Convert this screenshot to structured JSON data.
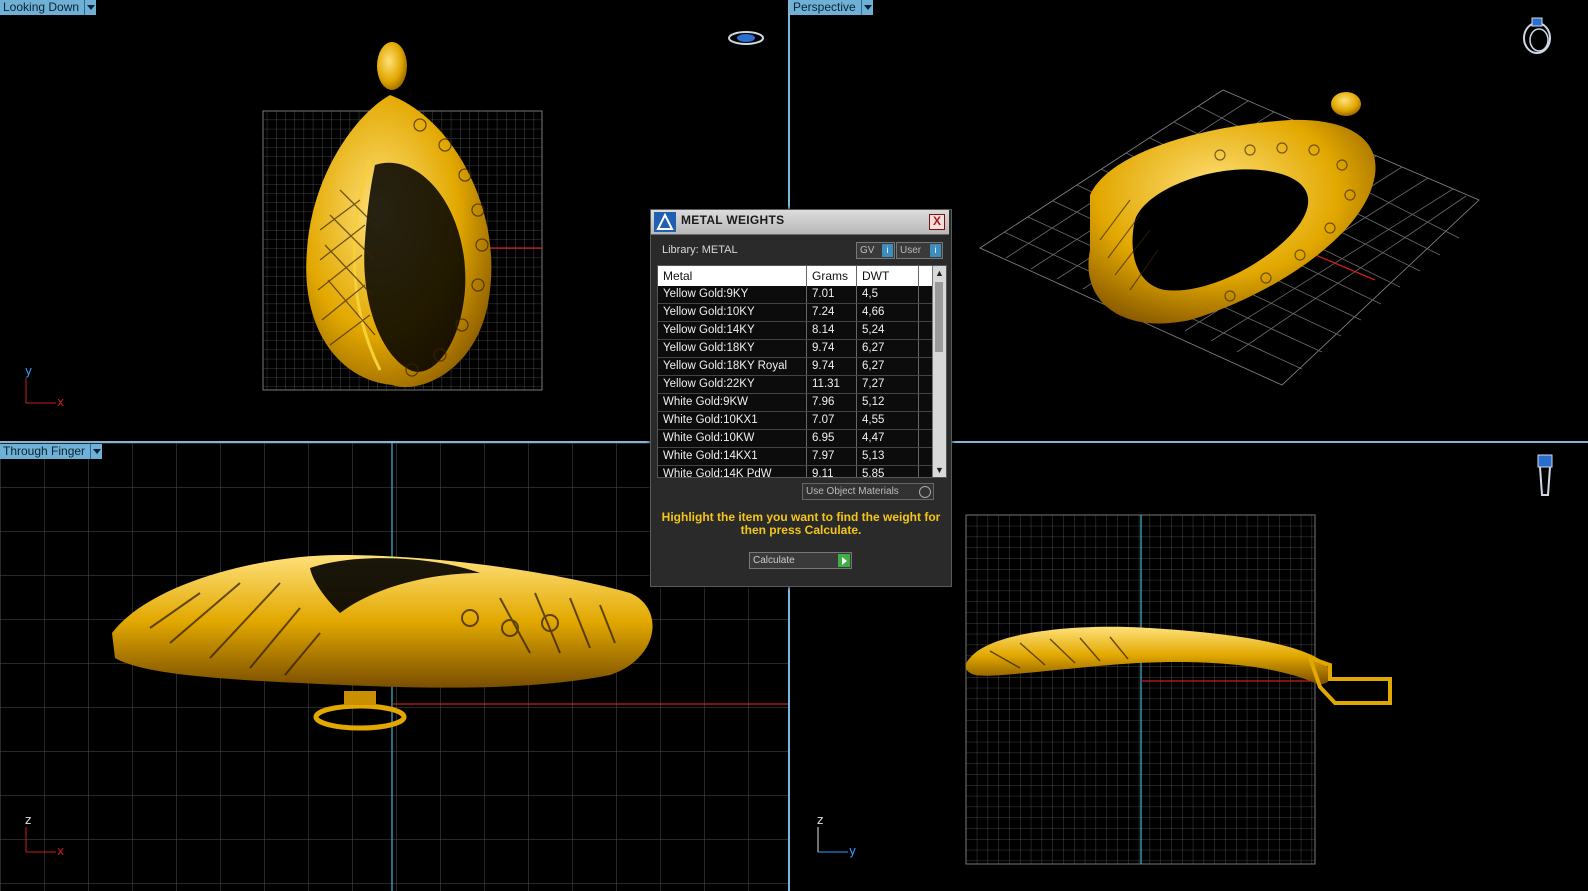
{
  "viewports": {
    "top_left": {
      "label": "Looking Down",
      "axis_a": "y",
      "axis_b": "x"
    },
    "top_right": {
      "label": "Perspective"
    },
    "bottom_left": {
      "label": "Through Finger",
      "axis_a": "z",
      "axis_b": "x"
    },
    "bottom_right": {
      "axis_a": "z",
      "axis_b": "y"
    }
  },
  "dialog": {
    "title": "METAL WEIGHTS",
    "close": "X",
    "library_label": "Library: METAL",
    "gv_label": "GV",
    "user_label": "User",
    "columns": [
      "Metal",
      "Grams",
      "DWT"
    ],
    "rows": [
      [
        "Yellow Gold:9KY",
        "7.01",
        "4,5"
      ],
      [
        "Yellow Gold:10KY",
        "7.24",
        "4,66"
      ],
      [
        "Yellow Gold:14KY",
        "8.14",
        "5,24"
      ],
      [
        "Yellow Gold:18KY",
        "9.74",
        "6,27"
      ],
      [
        "Yellow Gold:18KY Royal",
        "9.74",
        "6,27"
      ],
      [
        "Yellow Gold:22KY",
        "11.31",
        "7,27"
      ],
      [
        "White Gold:9KW",
        "7.96",
        "5,12"
      ],
      [
        "White Gold:10KX1",
        "7.07",
        "4,55"
      ],
      [
        "White Gold:10KW",
        "6.95",
        "4,47"
      ],
      [
        "White Gold:14KX1",
        "7.97",
        "5,13"
      ],
      [
        "White Gold:14K PdW",
        "9.11",
        "5,85"
      ]
    ],
    "use_object_materials": "Use Object Materials",
    "hint": "Highlight the item you want to find the weight for then press Calculate.",
    "calculate": "Calculate"
  },
  "colors": {
    "viewport_label_bg": "#6fb1d6",
    "gold": "#e2a800",
    "grid": "#5a5a5a",
    "hint": "#f5c518"
  }
}
